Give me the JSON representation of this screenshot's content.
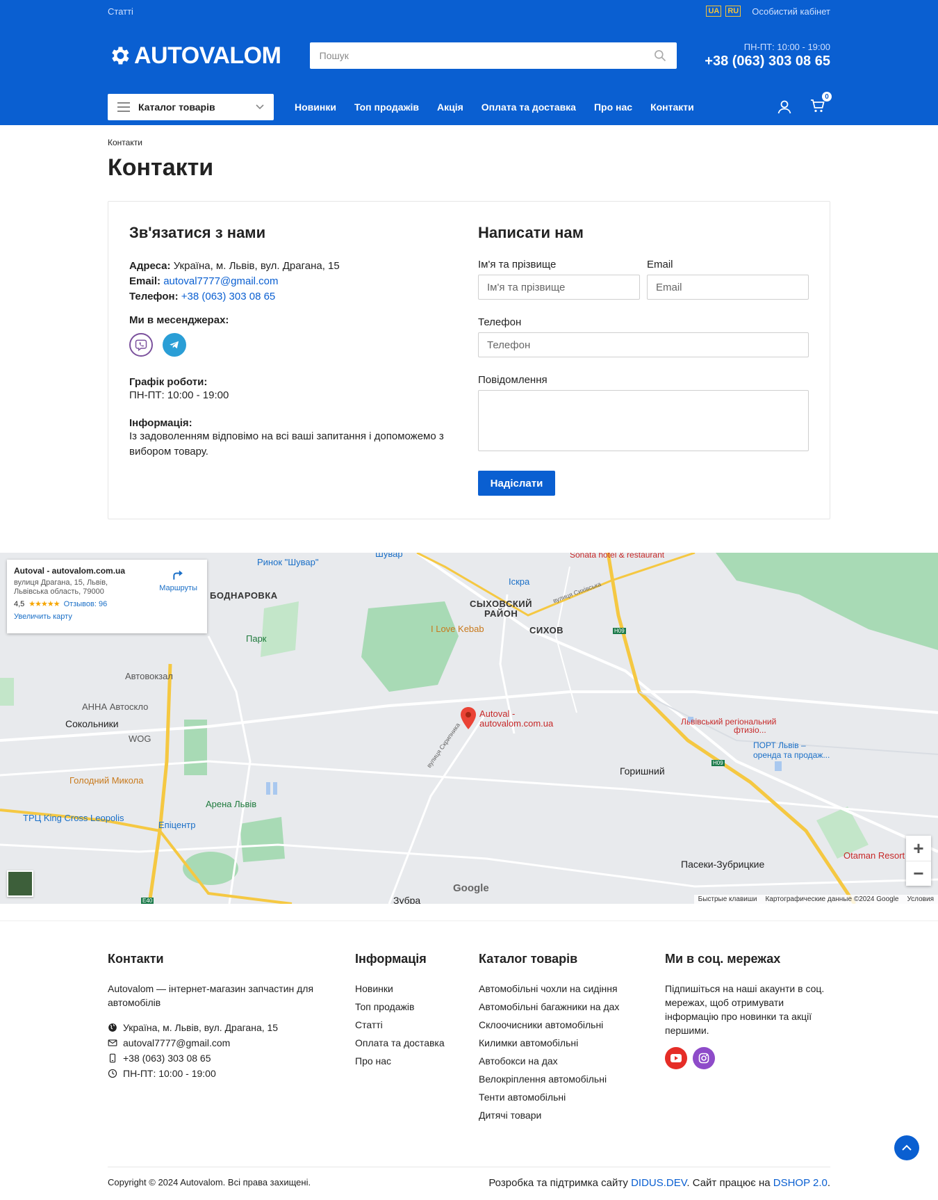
{
  "header": {
    "top_link": "Статті",
    "lang_ua": "UA",
    "lang_ru": "RU",
    "cabinet": "Особистий кабінет",
    "logo_text": "AUTOVALOM",
    "search_placeholder": "Пошук",
    "hours": "ПН-ПТ: 10:00 - 19:00",
    "phone": "+38 (063) 303 08 65",
    "catalog_label": "Каталог товарів",
    "nav": [
      "Новинки",
      "Топ продажів",
      "Акція",
      "Оплата та доставка",
      "Про нас",
      "Контакти"
    ],
    "cart_count": "0"
  },
  "page": {
    "breadcrumb": "Контакти",
    "title": "Контакти"
  },
  "contact": {
    "heading": "Зв'язатися з нами",
    "address_label": "Адреса:",
    "address": "Україна, м. Львів, вул. Драгана, 15",
    "email_label": "Email:",
    "email": "autoval7777@gmail.com",
    "phone_label": "Телефон:",
    "phone": "+38 (063) 303 08 65",
    "messengers_label": "Ми в месенджерах:",
    "schedule_label": "Графік роботи:",
    "schedule": "ПН-ПТ: 10:00 - 19:00",
    "info_label": "Інформація:",
    "info_line1": "Із задоволенням відповімо на всі ваші запитання і допоможемо з",
    "info_line2": "вибором товару."
  },
  "form": {
    "heading": "Написати нам",
    "name_label": "Ім'я та прізвище",
    "name_placeholder": "Ім'я та прізвище",
    "email_label": "Email",
    "email_placeholder": "Email",
    "phone_label": "Телефон",
    "phone_placeholder": "Телефон",
    "message_label": "Повідомлення",
    "submit": "Надіслати"
  },
  "map": {
    "card_title": "Autoval - autovalom.com.ua",
    "card_address1": "вулиця Драгана, 15, Львів,",
    "card_address2": "Львівська область, 79000",
    "rating": "4,5",
    "stars": "★★★★★",
    "reviews": "Отзывов: 96",
    "route": "Маршруты",
    "enlarge": "Увеличить карту",
    "zoom_in": "+",
    "zoom_out": "−",
    "google": "Google",
    "attrib_keys": "Быстрые клавиши",
    "attrib_data": "Картографические данные ©2024 Google",
    "attrib_terms": "Условия",
    "pin_line1": "Autoval -",
    "pin_line2": "autovalom.com.ua",
    "labels": {
      "shuvar": "Ринок \"Шувар\"",
      "shuvar2": "Шувар",
      "sonata": "Sonata hotel & restaurant",
      "iskra": "Іскра",
      "bodnarovka": "БОДНАРОВКА",
      "sykhiv_district1": "СЫХОВСКИЙ",
      "sykhiv_district2": "РАЙОН",
      "sykhiv": "СИХОВ",
      "kebab": "I Love Kebab",
      "park": "Парк",
      "avtovokzal": "Автовокзал",
      "anna": "АННА Автоскло",
      "sokolniki": "Сокольники",
      "wog": "WOG",
      "golodny": "Голодний Микола",
      "arena": "Арена Львів",
      "king_cross": "ТРЦ King Cross Leopolis",
      "epicentr": "Епіцентр",
      "zubra": "Зубра",
      "gorishniy": "Горишний",
      "paseky": "Пасеки-Зубрицкие",
      "otaman": "Otaman Resort",
      "hospital1": "Львівський регіональний",
      "hospital2": "фтизіо...",
      "port1": "ПОРТ Львів –",
      "port2": "оренда та продаж...",
      "skrynyka": "вулиця Скрипника",
      "sykhivska": "вулиця Сихівська",
      "h09a": "H09",
      "h09b": "H09",
      "e40": "E40"
    }
  },
  "footer": {
    "contacts_heading": "Контакти",
    "about_line1": "Autovalom — інтернет-магазин запчастин для",
    "about_line2": "автомобілів",
    "address": "Україна, м. Львів, вул. Драгана, 15",
    "email": "autoval7777@gmail.com",
    "phone": "+38 (063) 303 08 65",
    "hours": "ПН-ПТ: 10:00 - 19:00",
    "info_heading": "Інформація",
    "info_links": [
      "Новинки",
      "Топ продажів",
      "Статті",
      "Оплата та доставка",
      "Про нас"
    ],
    "catalog_heading": "Каталог товарів",
    "catalog_links": [
      "Автомобільні чохли на сидіння",
      "Автомобільні багажники на дах",
      "Склоочисники автомобільні",
      "Килимки автомобільні",
      "Автобокси на дах",
      "Велокріплення автомобільні",
      "Тенти автомобільні",
      "Дитячі товари"
    ],
    "social_heading": "Ми в соц. мережах",
    "social_text1": "Підпишіться на наші акаунти в соц.",
    "social_text2": "мережах, щоб отримувати",
    "social_text3": "інформацію про новинки та акції",
    "social_text4": "першими.",
    "copyright": "Copyright © 2024 Autovalom. Всі права захищені.",
    "dev_prefix": "Розробка та підтримка сайту ",
    "dev_link": "DIDUS.DEV",
    "dev_mid": ". Сайт працює на ",
    "dev_link2": "DSHOP 2.0",
    "dev_suffix": "."
  },
  "colors": {
    "brand": "#0a5fd1"
  }
}
